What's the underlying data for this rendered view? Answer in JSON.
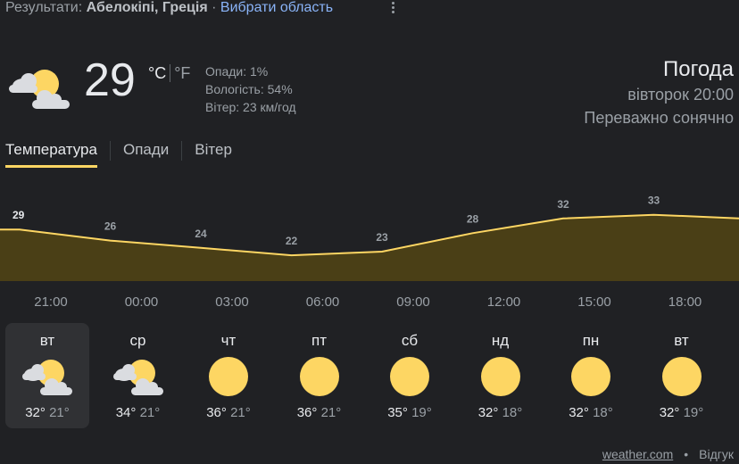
{
  "header": {
    "results_label": "Результати:",
    "location": "Абелокіпі, Греція",
    "separator": "·",
    "choose_area": "Вибрати область"
  },
  "current": {
    "icon": "partly-sunny-icon",
    "temperature": "29",
    "unit_c": "°C",
    "unit_f": "°F",
    "precip": "Опади: 1%",
    "humidity": "Вологість: 54%",
    "wind": "Вітер: 23 км/год"
  },
  "summary": {
    "title": "Погода",
    "datetime": "вівторок 20:00",
    "condition": "Переважно сонячно"
  },
  "tabs": [
    {
      "label": "Температура",
      "active": true
    },
    {
      "label": "Опади",
      "active": false
    },
    {
      "label": "Вітер",
      "active": false
    }
  ],
  "chart_data": {
    "type": "area",
    "x": [
      "21:00",
      "00:00",
      "03:00",
      "06:00",
      "09:00",
      "12:00",
      "15:00",
      "18:00"
    ],
    "values": [
      29,
      26,
      24,
      22,
      23,
      28,
      32,
      33
    ],
    "labels": [
      "29",
      "26",
      "24",
      "22",
      "23",
      "28",
      "32",
      "33"
    ],
    "ylim": [
      15,
      38
    ],
    "colors": {
      "line": "#fdd663",
      "fill": "#4a3f16"
    }
  },
  "forecast": [
    {
      "day": "вт",
      "icon": "partly-sunny-icon",
      "high": "32°",
      "low": "21°",
      "active": true
    },
    {
      "day": "ср",
      "icon": "partly-sunny-icon",
      "high": "34°",
      "low": "21°",
      "active": false
    },
    {
      "day": "чт",
      "icon": "sun-icon",
      "high": "36°",
      "low": "21°",
      "active": false
    },
    {
      "day": "пт",
      "icon": "sun-icon",
      "high": "36°",
      "low": "21°",
      "active": false
    },
    {
      "day": "сб",
      "icon": "sun-icon",
      "high": "35°",
      "low": "19°",
      "active": false
    },
    {
      "day": "нд",
      "icon": "sun-icon",
      "high": "32°",
      "low": "18°",
      "active": false
    },
    {
      "day": "пн",
      "icon": "sun-icon",
      "high": "32°",
      "low": "18°",
      "active": false
    },
    {
      "day": "вт",
      "icon": "sun-icon",
      "high": "32°",
      "low": "19°",
      "active": false
    }
  ],
  "footer": {
    "source": "weather.com",
    "dot": "•",
    "feedback": "Відгук"
  },
  "colors": {
    "background": "#202124",
    "accent": "#fdd663",
    "link": "#8ab4f8"
  }
}
